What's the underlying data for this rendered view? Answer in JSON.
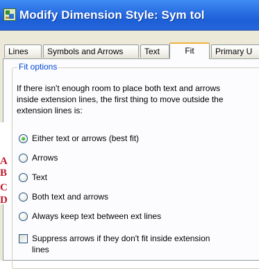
{
  "window": {
    "title": "Modify Dimension Style: Sym tol"
  },
  "tabs": [
    {
      "label": "Lines",
      "active": false
    },
    {
      "label": "Symbols and Arrows",
      "active": false
    },
    {
      "label": "Text",
      "active": false
    },
    {
      "label": "Fit",
      "active": true
    },
    {
      "label": "Primary U",
      "active": false
    }
  ],
  "fit_options": {
    "legend": "Fit options",
    "description": "If there isn't enough room to place both text and arrows inside extension lines, the first thing to move outside the extension lines is:",
    "options": [
      {
        "label": "Either text or arrows (best fit)",
        "selected": true
      },
      {
        "label": "Arrows",
        "selected": false
      },
      {
        "label": "Text",
        "selected": false
      },
      {
        "label": "Both text and arrows",
        "selected": false
      },
      {
        "label": "Always keep text between ext lines",
        "selected": false
      }
    ],
    "suppress_checkbox": {
      "label": "Suppress arrows if they don't fit inside extension lines",
      "checked": false
    }
  },
  "left_fragments": [
    "A",
    "B",
    "C",
    "D"
  ],
  "colors": {
    "titlebar": "#2a6fe3",
    "legend_text": "#0046d5",
    "tab_highlight": "#f3b03d",
    "radio_dot": "#21a121",
    "fragment_text": "#c0182b"
  }
}
